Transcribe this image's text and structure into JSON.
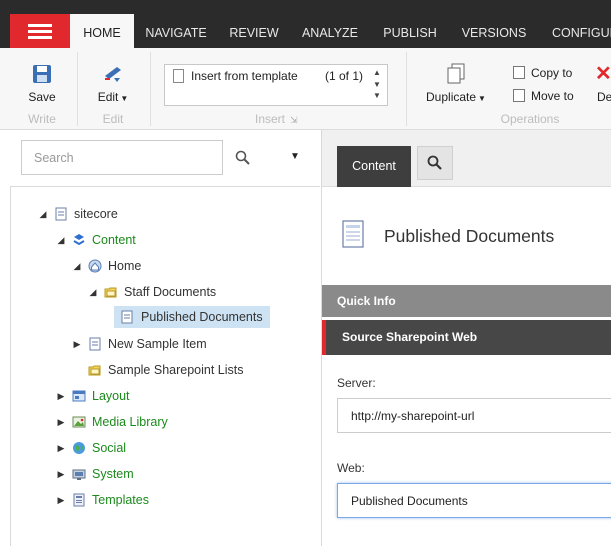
{
  "ribbon": {
    "tabs": [
      "HOME",
      "NAVIGATE",
      "REVIEW",
      "ANALYZE",
      "PUBLISH",
      "VERSIONS",
      "CONFIGUR"
    ],
    "active_tab": "HOME",
    "write": {
      "button": "Save",
      "label": "Write"
    },
    "edit": {
      "button": "Edit",
      "label": "Edit"
    },
    "insert": {
      "item": "Insert from template",
      "count": "(1 of 1)",
      "label": "Insert"
    },
    "operations": {
      "duplicate": "Duplicate",
      "copy_to": "Copy to",
      "move_to": "Move to",
      "delete_partial": "De",
      "label": "Operations"
    }
  },
  "search": {
    "placeholder": "Search"
  },
  "tree": [
    {
      "label": "sitecore",
      "icon": "page-icon",
      "color": "dark"
    },
    {
      "label": "Content",
      "icon": "content-icon",
      "color": "green"
    },
    {
      "label": "Home",
      "icon": "home-icon",
      "color": "dark"
    },
    {
      "label": "Staff Documents",
      "icon": "folder-icon",
      "color": "dark"
    },
    {
      "label": "Published Documents",
      "icon": "document-icon",
      "color": "dark",
      "selected": true
    },
    {
      "label": "New Sample Item",
      "icon": "document-icon",
      "color": "dark"
    },
    {
      "label": "Sample Sharepoint Lists",
      "icon": "folder-icon",
      "color": "dark"
    },
    {
      "label": "Layout",
      "icon": "layout-icon",
      "color": "green"
    },
    {
      "label": "Media Library",
      "icon": "media-icon",
      "color": "green"
    },
    {
      "label": "Social",
      "icon": "globe-icon",
      "color": "green"
    },
    {
      "label": "System",
      "icon": "system-icon",
      "color": "green"
    },
    {
      "label": "Templates",
      "icon": "templates-icon",
      "color": "green"
    }
  ],
  "content": {
    "tab_label": "Content",
    "title": "Published Documents",
    "section_quick_info": "Quick Info",
    "section_source": "Source Sharepoint Web",
    "server_label": "Server:",
    "server_value": "http://my-sharepoint-url",
    "web_label": "Web:",
    "web_value": "Published Documents"
  },
  "colors": {
    "accent": "#e0282d",
    "dark_bar": "#2b2b2b",
    "tree_green": "#1b8a1b",
    "selection": "#cde3f3"
  }
}
